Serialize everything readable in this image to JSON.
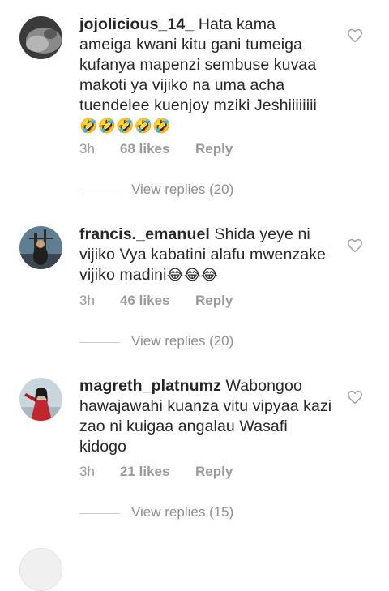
{
  "comments": [
    {
      "username": "jojolicious_14_",
      "text": "Hata kama ameiga kwani kitu gani tumeiga kufanya mapenzi sembuse kuvaa makoti ya vijiko na uma acha tuendelee kuenjoy mziki Jeshiiiiiiii",
      "emoji": "🤣🤣🤣🤣🤣",
      "time": "3h",
      "likes": "68 likes",
      "reply": "Reply",
      "view_replies": "View replies (20)"
    },
    {
      "username": "francis._emanuel",
      "text": "Shida yeye ni vijiko Vya kabatini alafu mwenzake vijiko madini",
      "emoji": "😂😂😂",
      "time": "3h",
      "likes": "46 likes",
      "reply": "Reply",
      "view_replies": "View replies (20)"
    },
    {
      "username": "magreth_platnumz",
      "text": "Wabongoo hawajawahi kuanza vitu vipyaa kazi zao ni kuigaa angalau Wasafi kidogo",
      "emoji": "",
      "time": "3h",
      "likes": "21 likes",
      "reply": "Reply",
      "view_replies": "View replies (15)"
    }
  ],
  "colors": {
    "text": "#262626",
    "meta": "#9a9a9a",
    "divider": "#c7c7c7"
  },
  "icons": [
    "heart-outline-icon",
    "avatar"
  ]
}
